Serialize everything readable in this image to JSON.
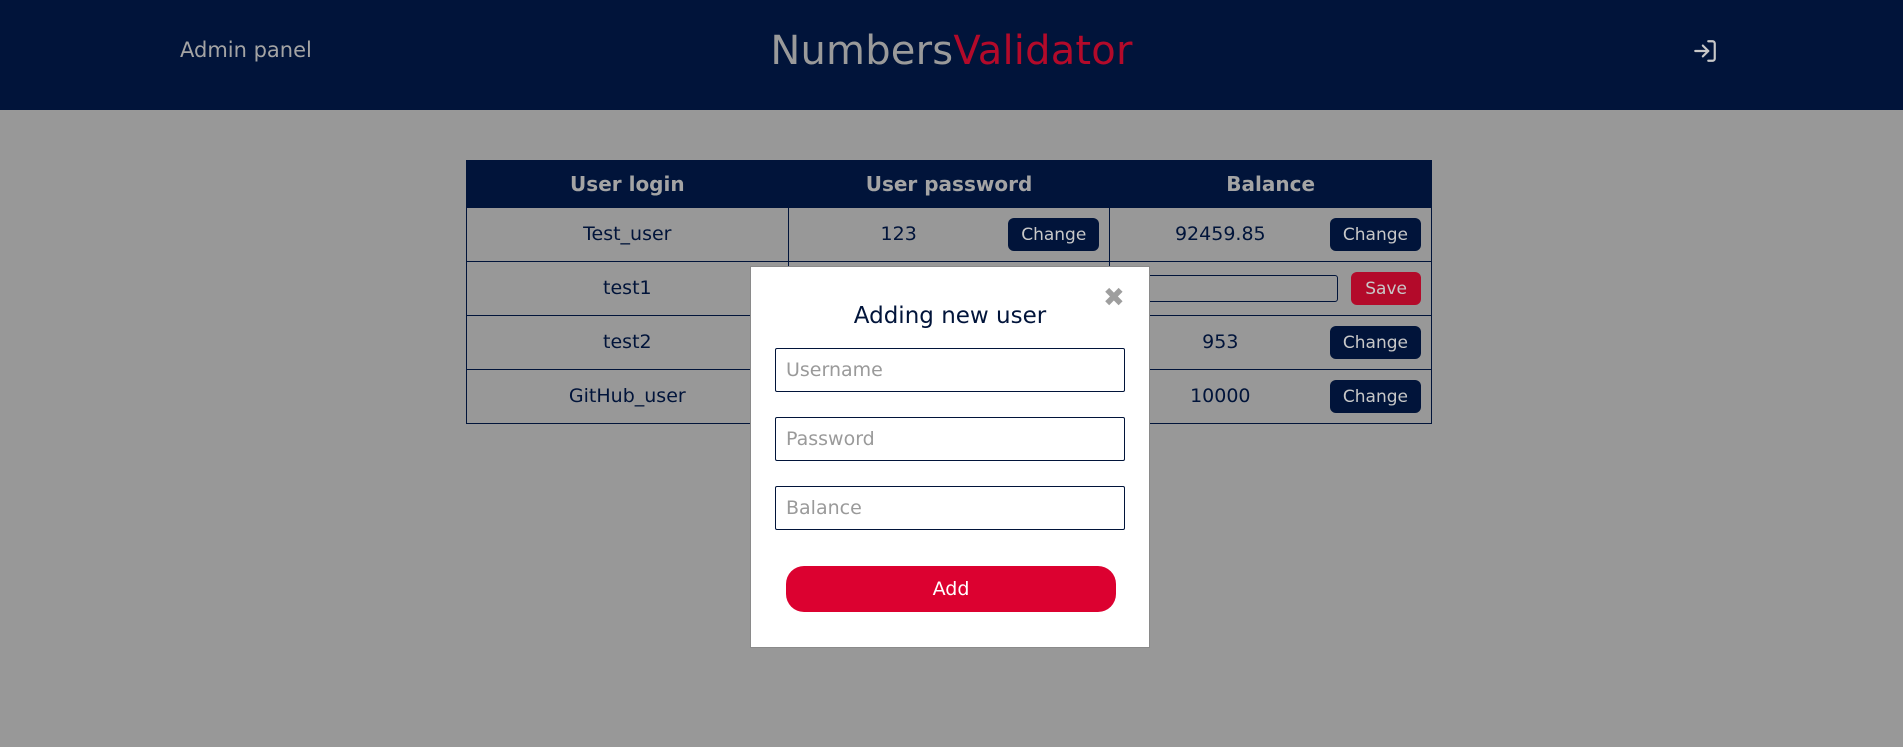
{
  "header": {
    "admin_label": "Admin panel",
    "logo_part1": "Numbers",
    "logo_part2": "Validator",
    "logout_icon": "sign-in-arrow-icon"
  },
  "table": {
    "columns": [
      "User login",
      "User password",
      "Balance"
    ],
    "rows": [
      {
        "login": "Test_user",
        "password": "123",
        "balance": "92459.85",
        "password_action": "Change",
        "balance_action": "Change"
      },
      {
        "login": "test1",
        "password": "",
        "balance": "",
        "password_action": "",
        "balance_action": "Save"
      },
      {
        "login": "test2",
        "password": "",
        "balance": "953",
        "password_action": "",
        "balance_action": "Change"
      },
      {
        "login": "GitHub_user",
        "password": "",
        "balance": "10000",
        "password_action": "",
        "balance_action": "Change"
      }
    ]
  },
  "modal": {
    "title": "Adding new user",
    "close_icon": "close-icon",
    "username_placeholder": "Username",
    "password_placeholder": "Password",
    "balance_placeholder": "Balance",
    "add_label": "Add"
  },
  "colors": {
    "navy": "#01143a",
    "accent_red": "#dc0130",
    "logo_red": "#b30a2a",
    "overlay_gray": "#989898"
  }
}
